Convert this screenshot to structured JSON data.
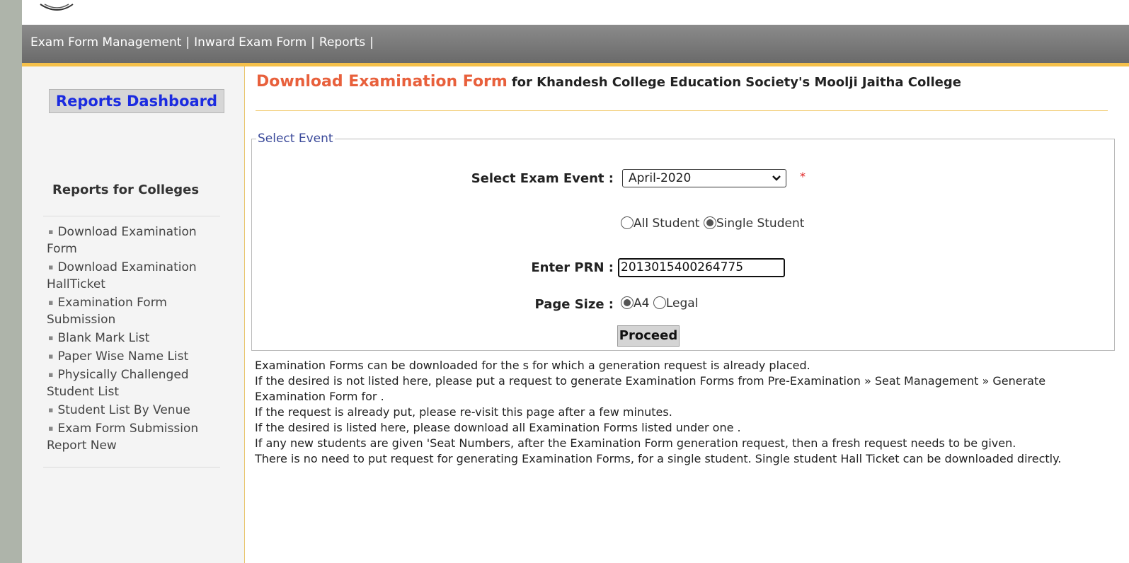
{
  "topnav": {
    "items": [
      "Exam Form Management",
      "Inward Exam Form",
      "Reports"
    ],
    "separator": "|"
  },
  "sidebar": {
    "dashboard_button": "Reports Dashboard",
    "heading": "Reports for Colleges",
    "bullet": "▪",
    "items": [
      "Download Examination Form",
      "Download Examination HallTicket",
      "Examination Form Submission",
      "Blank Mark List",
      "Paper Wise Name List",
      "Physically Challenged Student List",
      "Student List By Venue",
      "Exam Form Submission Report New"
    ]
  },
  "main": {
    "title": "Download Examination Form",
    "subtitle": "for Khandesh College Education Society's Moolji Jaitha College",
    "fieldset_legend": "Select Event",
    "exam_event_label": "Select Exam Event :",
    "exam_event_value": "April-2020",
    "required_mark": "*",
    "student_option_all": "All Student",
    "student_option_single": "Single Student",
    "student_selected": "Single Student",
    "prn_label": "Enter PRN :",
    "prn_value": "2013015400264775",
    "page_size_label": "Page Size :",
    "page_size_a4": "A4",
    "page_size_legal": "Legal",
    "page_size_selected": "A4",
    "proceed_button": "Proceed"
  },
  "notes": [
    "Examination Forms can be downloaded for the s for which a generation request is already placed.",
    "If the desired  is not listed here, please put a request to generate Examination Forms from Pre-Examination » Seat Management » Generate Examination Form for .",
    "If the request is already put, please re-visit this page after a few minutes.",
    "If the desired is listed here, please download all Examination Forms listed under one .",
    "If any new students are given 'Seat Numbers, after the Examination Form generation request, then a fresh request needs to be given.",
    "There is no need to put request for generating Examination Forms, for a single student. Single student Hall Ticket can be downloaded directly."
  ],
  "colors": {
    "title_accent": "#e8603c",
    "nav_border": "#f5c04a",
    "dashboard_text": "#1b2be0"
  }
}
